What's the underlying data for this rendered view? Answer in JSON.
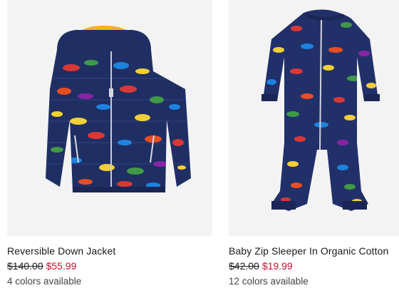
{
  "products": [
    {
      "name": "Reversible Down Jacket",
      "original_price": "$140.00",
      "sale_price": "$55.99",
      "colors_text": "4 colors available",
      "image_icon": "dino-print-puffer-jacket-image"
    },
    {
      "name": "Baby Zip Sleeper In Organic Cotton",
      "original_price": "$42.00",
      "sale_price": "$19.99",
      "colors_text": "12 colors available",
      "image_icon": "dino-print-sleeper-image"
    }
  ],
  "colors": {
    "tile_background": "#f3f3f3",
    "garment_navy": "#1f2f63",
    "hood_lining": "#f0b419",
    "sale_red": "#c8102e",
    "text": "#1a1a1a"
  }
}
